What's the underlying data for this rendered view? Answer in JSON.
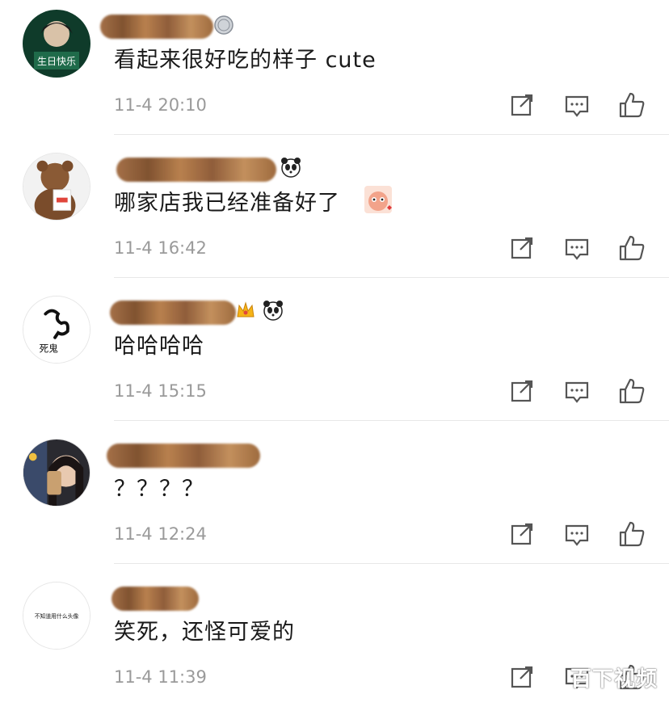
{
  "comments": [
    {
      "text": "看起来很好吃的样子 cute",
      "time": "11-4 20:10",
      "avatar_caption": "生日快乐"
    },
    {
      "text": "哪家店我已经准备好了",
      "time": "11-4 16:42",
      "avatar_caption": ""
    },
    {
      "text": "哈哈哈哈",
      "time": "11-4 15:15",
      "avatar_caption": "死鬼"
    },
    {
      "text": "？？？？",
      "time": "11-4 12:24",
      "avatar_caption": ""
    },
    {
      "text": "笑死，还怪可爱的",
      "time": "11-4 11:39",
      "avatar_caption": "不知道用什么头像"
    }
  ],
  "watermark": "百下视频",
  "icons": [
    "share-icon",
    "comment-icon",
    "like-icon"
  ],
  "colors": {
    "text": "#1a1a1a",
    "time": "#9a9a9a",
    "divider": "#e8e8e8",
    "icon": "#555555"
  }
}
